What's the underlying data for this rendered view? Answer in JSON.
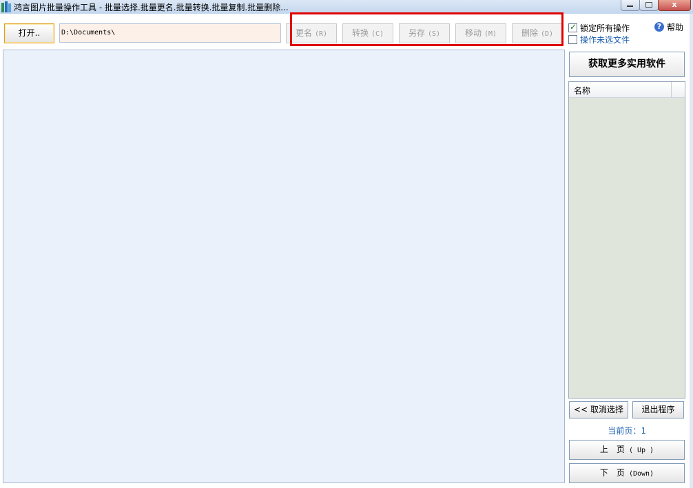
{
  "window": {
    "title": "鸿言图片批量操作工具 - 批量选择.批量更名.批量转换.批量复制.批量删除...",
    "close_glyph": "x"
  },
  "toolbar": {
    "open_label": "打开..",
    "path_value": "D:\\Documents\\",
    "actions": [
      {
        "label": "更名",
        "key": "(R)"
      },
      {
        "label": "转换",
        "key": "(C)"
      },
      {
        "label": "另存",
        "key": "(S)"
      },
      {
        "label": "移动",
        "key": "(M)"
      },
      {
        "label": "删除",
        "key": "(D)"
      }
    ],
    "actions_enabled": false
  },
  "options": {
    "lock_all_label": "锁定所有操作",
    "lock_all_checked": true,
    "unselected_label": "操作未选文件",
    "unselected_checked": false,
    "help_label": "帮助",
    "help_icon": "?"
  },
  "sidebar": {
    "more_software_label": "获取更多实用软件",
    "list_header": "名称",
    "cancel_select_label": "<< 取消选择",
    "exit_label": "退出程序",
    "current_page_label": "当前页：",
    "current_page": "1",
    "page_up_label": "上　页",
    "page_up_key": "( Up )",
    "page_down_label": "下　页",
    "page_down_key": "(Down)"
  },
  "colors": {
    "highlight_border": "#e00000",
    "main_panel_bg": "#eaf1fb",
    "path_bg": "#fdf0e8",
    "page_text": "#1a5fb0"
  }
}
